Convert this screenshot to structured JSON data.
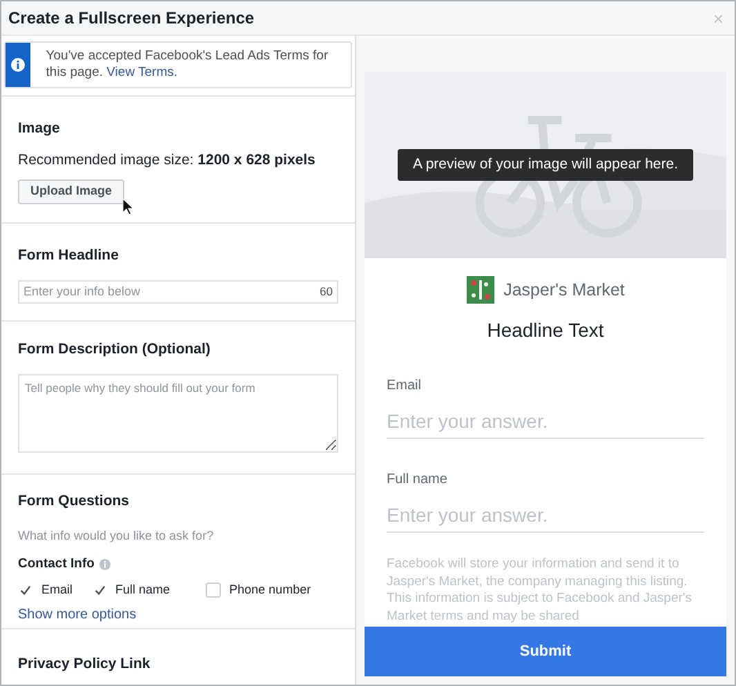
{
  "window": {
    "title": "Create a Fullscreen Experience",
    "close": "×"
  },
  "notice": {
    "text": "You've accepted Facebook's Lead Ads Terms for this page.",
    "link": "View Terms."
  },
  "image_section": {
    "heading": "Image",
    "recommendation": "Recommended image size: **1200 x 628 pixels**",
    "button": "Upload Image"
  },
  "headline_section": {
    "heading": "Form Headline",
    "placeholder": "Enter your info below",
    "counter": "60"
  },
  "description_section": {
    "heading": "Form Description (Optional)",
    "placeholder": "Tell people why they should fill out your form"
  },
  "questions_section": {
    "heading": "Form Questions",
    "prompt": "What info would you like to ask for?",
    "group_label": "Contact Info",
    "options": [
      {
        "label": "Email",
        "checked": true
      },
      {
        "label": "Full name",
        "checked": true
      },
      {
        "label": "Phone number",
        "checked": false
      }
    ],
    "more_link": "Show more options"
  },
  "privacy_section": {
    "heading": "Privacy Policy Link"
  },
  "preview": {
    "image_caption": "A preview of your image will appear here.",
    "page_name": "Jasper's Market",
    "headline": "Headline Text",
    "fields": [
      {
        "label": "Email",
        "placeholder": "Enter your answer."
      },
      {
        "label": "Full name",
        "placeholder": "Enter your answer."
      }
    ],
    "disclaimer": "Facebook will store your information and send it to Jasper's Market, the company managing this listing. This information is subject to Facebook and Jasper's Market terms and may be shared",
    "submit": "Submit"
  }
}
